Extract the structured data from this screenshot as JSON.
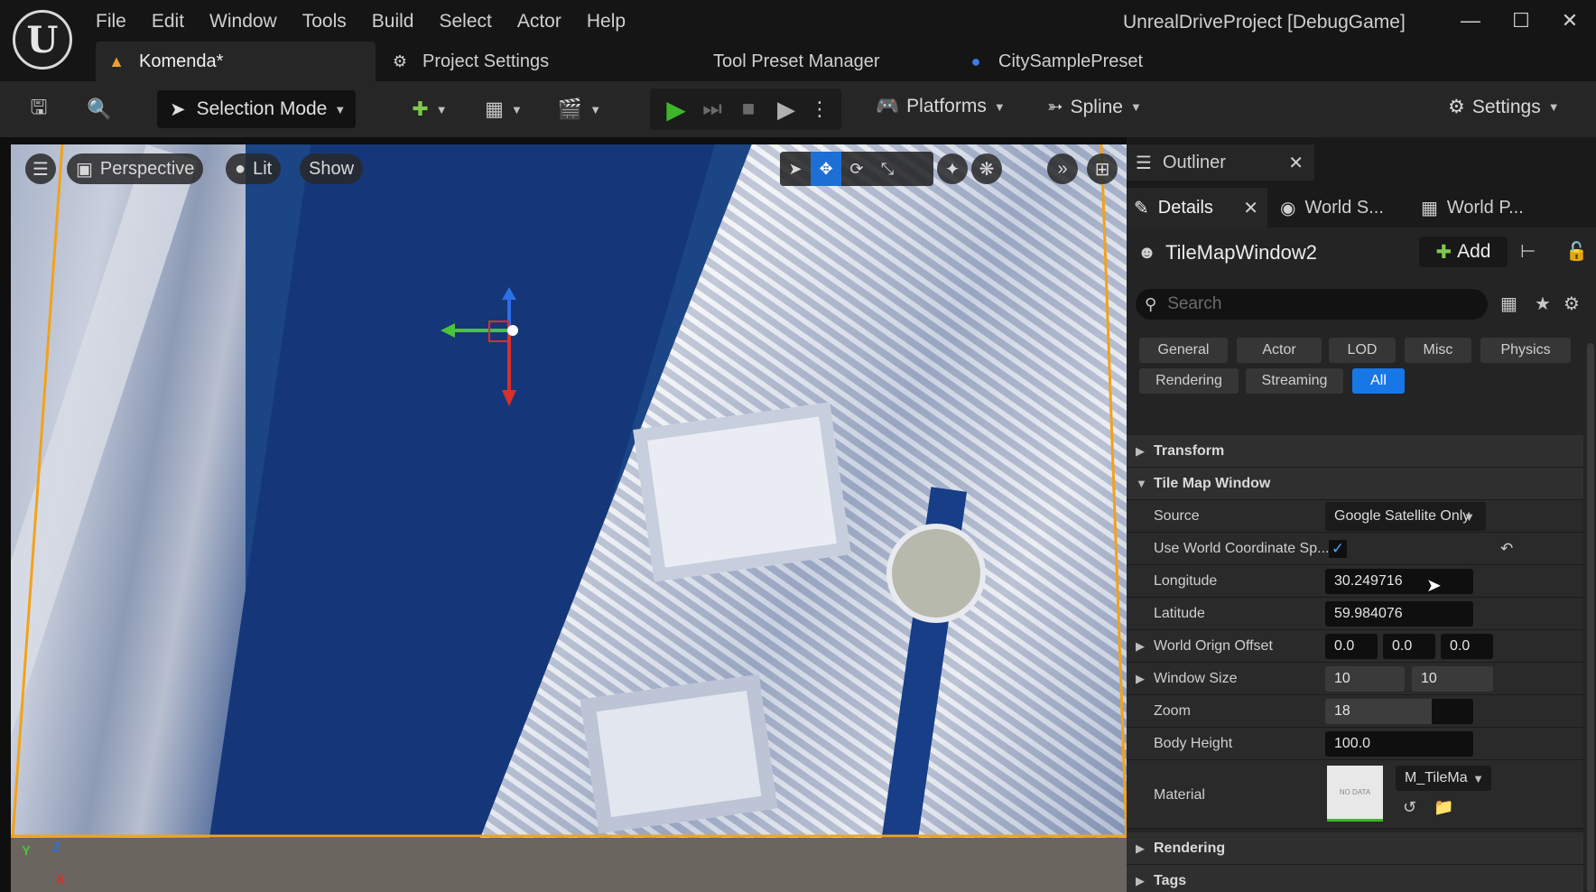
{
  "app": {
    "window_title": "UnrealDriveProject [DebugGame]",
    "logo_glyph": "U"
  },
  "menu": [
    "File",
    "Edit",
    "Window",
    "Tools",
    "Build",
    "Select",
    "Actor",
    "Help"
  ],
  "tabs": {
    "level": "Komenda*",
    "project_settings": "Project Settings",
    "tool_preset": "Tool Preset Manager",
    "city_sample": "CitySamplePreset"
  },
  "toolbar": {
    "selection_mode": "Selection Mode",
    "platforms": "Platforms",
    "spline": "Spline",
    "settings": "Settings"
  },
  "viewport": {
    "perspective": "Perspective",
    "lit": "Lit",
    "show": "Show",
    "axis_y": "Y",
    "axis_z": "Z",
    "axis_x": "X"
  },
  "outliner": {
    "title": "Outliner"
  },
  "details_tabs": {
    "details": "Details",
    "world_settings": "World S...",
    "world_partition": "World P..."
  },
  "details": {
    "actor_name": "TileMapWindow2",
    "add_label": "Add",
    "search_placeholder": "Search",
    "filters": [
      "General",
      "Actor",
      "LOD",
      "Misc",
      "Physics",
      "Rendering",
      "Streaming",
      "All"
    ],
    "active_filter": "All",
    "categories": {
      "transform": "Transform",
      "tile_map_window": "Tile Map Window",
      "rendering": "Rendering",
      "tags": "Tags"
    },
    "properties": {
      "source_label": "Source",
      "source_value": "Google Satellite Only",
      "use_world_label": "Use World Coordinate Sp...",
      "use_world_checked": true,
      "longitude_label": "Longitude",
      "longitude_value": "30.249716",
      "latitude_label": "Latitude",
      "latitude_value": "59.984076",
      "origin_label": "World Orign Offset",
      "origin_x": "0.0",
      "origin_y": "0.0",
      "origin_z": "0.0",
      "window_size_label": "Window Size",
      "window_size_x": "10",
      "window_size_y": "10",
      "zoom_label": "Zoom",
      "zoom_value": "18",
      "body_height_label": "Body Height",
      "body_height_value": "100.0",
      "material_label": "Material",
      "material_value": "M_TileMa",
      "material_thumb_text": "NO DATA"
    }
  },
  "colors": {
    "accent": "#1877e6",
    "play": "#3fb52a",
    "water": "#15377a"
  }
}
